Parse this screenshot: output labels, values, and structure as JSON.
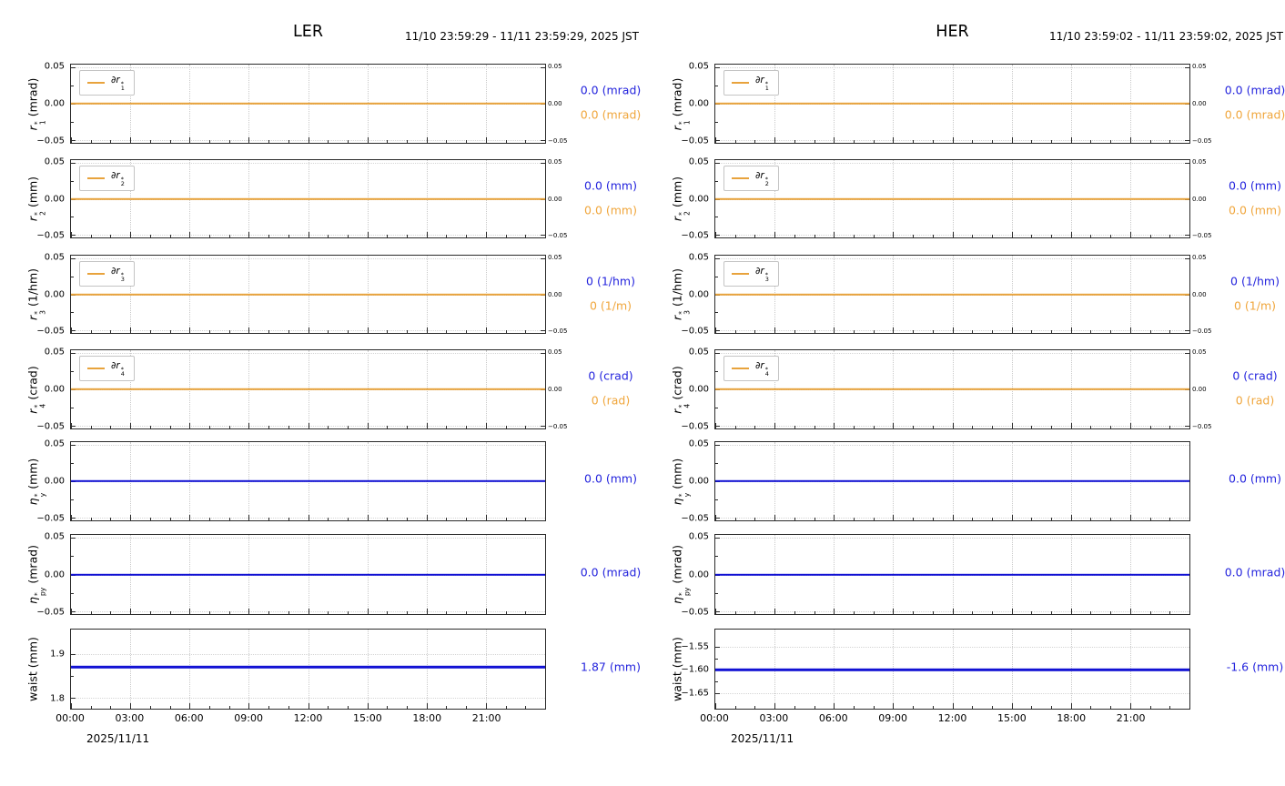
{
  "colors": {
    "orange": "#e8a33c",
    "orange_text": "#f0a63c",
    "blue": "#1212d4",
    "blue_text": "#2424dd",
    "grid": "#c9c9c9",
    "axis": "#2a2a2a"
  },
  "chart_data": [
    {
      "type": "line",
      "title": "LER",
      "time_range": "11/10 23:59:29 - 11/11 23:59:29, 2025 JST",
      "x": {
        "ticks": [
          "00:00",
          "03:00",
          "06:00",
          "09:00",
          "12:00",
          "15:00",
          "18:00",
          "21:00"
        ],
        "range_hours": [
          0,
          24
        ],
        "date_label": "2025/11/11"
      },
      "subplots": [
        {
          "ylabel": {
            "base": "r",
            "sub": "1",
            "sup": "*",
            "unit": "(mrad)"
          },
          "ylim": [
            -0.054,
            0.054
          ],
          "yticks": [
            {
              "label": "0.05",
              "value": 0.05
            },
            {
              "label": "0.00",
              "value": 0
            },
            {
              "label": "−0.05",
              "value": -0.05
            }
          ],
          "right_ticks": true,
          "legend": {
            "base": "∂r",
            "sub": "1",
            "sup": "*"
          },
          "series": [
            {
              "name": "∂r1*",
              "color": "#e8a33c",
              "value": 0
            }
          ],
          "readouts": [
            {
              "text": "0.0 (mrad)",
              "color": "#2424dd"
            },
            {
              "text": "0.0 (mrad)",
              "color": "#f0a63c"
            }
          ]
        },
        {
          "ylabel": {
            "base": "r",
            "sub": "2",
            "sup": "*",
            "unit": "(mm)"
          },
          "ylim": [
            -0.054,
            0.054
          ],
          "yticks": [
            {
              "label": "0.05",
              "value": 0.05
            },
            {
              "label": "0.00",
              "value": 0
            },
            {
              "label": "−0.05",
              "value": -0.05
            }
          ],
          "right_ticks": true,
          "legend": {
            "base": "∂r",
            "sub": "2",
            "sup": "*"
          },
          "series": [
            {
              "name": "∂r2*",
              "color": "#e8a33c",
              "value": 0
            }
          ],
          "readouts": [
            {
              "text": "0.0 (mm)",
              "color": "#2424dd"
            },
            {
              "text": "0.0 (mm)",
              "color": "#f0a63c"
            }
          ]
        },
        {
          "ylabel": {
            "base": "r",
            "sub": "3",
            "sup": "*",
            "unit": "(1/hm)"
          },
          "ylim": [
            -0.054,
            0.054
          ],
          "yticks": [
            {
              "label": "0.05",
              "value": 0.05
            },
            {
              "label": "0.00",
              "value": 0
            },
            {
              "label": "−0.05",
              "value": -0.05
            }
          ],
          "right_ticks": true,
          "legend": {
            "base": "∂r",
            "sub": "3",
            "sup": "*"
          },
          "series": [
            {
              "name": "∂r3*",
              "color": "#e8a33c",
              "value": 0
            }
          ],
          "readouts": [
            {
              "text": "0 (1/hm)",
              "color": "#2424dd"
            },
            {
              "text": "0 (1/m)",
              "color": "#f0a63c"
            }
          ]
        },
        {
          "ylabel": {
            "base": "r",
            "sub": "4",
            "sup": "*",
            "unit": "(crad)"
          },
          "ylim": [
            -0.054,
            0.054
          ],
          "yticks": [
            {
              "label": "0.05",
              "value": 0.05
            },
            {
              "label": "0.00",
              "value": 0
            },
            {
              "label": "−0.05",
              "value": -0.05
            }
          ],
          "right_ticks": true,
          "legend": {
            "base": "∂r",
            "sub": "4",
            "sup": "*"
          },
          "series": [
            {
              "name": "∂r4*",
              "color": "#e8a33c",
              "value": 0
            }
          ],
          "readouts": [
            {
              "text": "0 (crad)",
              "color": "#2424dd"
            },
            {
              "text": "0 (rad)",
              "color": "#f0a63c"
            }
          ]
        },
        {
          "ylabel": {
            "base": "η",
            "sub": "y",
            "sup": "*",
            "unit": "(mm)"
          },
          "ylim": [
            -0.054,
            0.054
          ],
          "yticks": [
            {
              "label": "0.05",
              "value": 0.05
            },
            {
              "label": "0.00",
              "value": 0
            },
            {
              "label": "−0.05",
              "value": -0.05
            }
          ],
          "right_ticks": false,
          "series": [
            {
              "name": "ηy*",
              "color": "#1212d4",
              "value": 0
            }
          ],
          "readouts": [
            {
              "text": "0.0 (mm)",
              "color": "#2424dd"
            }
          ]
        },
        {
          "ylabel": {
            "base": "η",
            "sub": "py",
            "sup": "*",
            "unit": "(mrad)"
          },
          "ylim": [
            -0.054,
            0.054
          ],
          "yticks": [
            {
              "label": "0.05",
              "value": 0.05
            },
            {
              "label": "0.00",
              "value": 0
            },
            {
              "label": "−0.05",
              "value": -0.05
            }
          ],
          "right_ticks": false,
          "series": [
            {
              "name": "ηpy*",
              "color": "#1212d4",
              "value": 0
            }
          ],
          "readouts": [
            {
              "text": "0.0 (mrad)",
              "color": "#2424dd"
            }
          ]
        },
        {
          "ylabel": {
            "plain": "waist (mm)"
          },
          "ylim": [
            1.7746,
            1.9564
          ],
          "yticks": [
            {
              "label": "1.9",
              "value": 1.9
            },
            {
              "label": "1.8",
              "value": 1.8
            }
          ],
          "right_ticks": false,
          "series": [
            {
              "name": "waist",
              "color": "#1212d4",
              "value": 1.87
            }
          ],
          "readouts": [
            {
              "text": "1.87 (mm)",
              "color": "#2424dd"
            }
          ]
        }
      ]
    },
    {
      "type": "line",
      "title": "HER",
      "time_range": "11/10 23:59:02 - 11/11 23:59:02, 2025 JST",
      "x": {
        "ticks": [
          "00:00",
          "03:00",
          "06:00",
          "09:00",
          "12:00",
          "15:00",
          "18:00",
          "21:00"
        ],
        "range_hours": [
          0,
          24
        ],
        "date_label": "2025/11/11"
      },
      "subplots": [
        {
          "ylabel": {
            "base": "r",
            "sub": "1",
            "sup": "*",
            "unit": "(mrad)"
          },
          "ylim": [
            -0.054,
            0.054
          ],
          "yticks": [
            {
              "label": "0.05",
              "value": 0.05
            },
            {
              "label": "0.00",
              "value": 0
            },
            {
              "label": "−0.05",
              "value": -0.05
            }
          ],
          "right_ticks": true,
          "legend": {
            "base": "∂r",
            "sub": "1",
            "sup": "*"
          },
          "series": [
            {
              "name": "∂r1*",
              "color": "#e8a33c",
              "value": 0
            }
          ],
          "readouts": [
            {
              "text": "0.0 (mrad)",
              "color": "#2424dd"
            },
            {
              "text": "0.0 (mrad)",
              "color": "#f0a63c"
            }
          ]
        },
        {
          "ylabel": {
            "base": "r",
            "sub": "2",
            "sup": "*",
            "unit": "(mm)"
          },
          "ylim": [
            -0.054,
            0.054
          ],
          "yticks": [
            {
              "label": "0.05",
              "value": 0.05
            },
            {
              "label": "0.00",
              "value": 0
            },
            {
              "label": "−0.05",
              "value": -0.05
            }
          ],
          "right_ticks": true,
          "legend": {
            "base": "∂r",
            "sub": "2",
            "sup": "*"
          },
          "series": [
            {
              "name": "∂r2*",
              "color": "#e8a33c",
              "value": 0
            }
          ],
          "readouts": [
            {
              "text": "0.0 (mm)",
              "color": "#2424dd"
            },
            {
              "text": "0.0 (mm)",
              "color": "#f0a63c"
            }
          ]
        },
        {
          "ylabel": {
            "base": "r",
            "sub": "3",
            "sup": "*",
            "unit": "(1/hm)"
          },
          "ylim": [
            -0.054,
            0.054
          ],
          "yticks": [
            {
              "label": "0.05",
              "value": 0.05
            },
            {
              "label": "0.00",
              "value": 0
            },
            {
              "label": "−0.05",
              "value": -0.05
            }
          ],
          "right_ticks": true,
          "legend": {
            "base": "∂r",
            "sub": "3",
            "sup": "*"
          },
          "series": [
            {
              "name": "∂r3*",
              "color": "#e8a33c",
              "value": 0
            }
          ],
          "readouts": [
            {
              "text": "0 (1/hm)",
              "color": "#2424dd"
            },
            {
              "text": "0 (1/m)",
              "color": "#f0a63c"
            }
          ]
        },
        {
          "ylabel": {
            "base": "r",
            "sub": "4",
            "sup": "*",
            "unit": "(crad)"
          },
          "ylim": [
            -0.054,
            0.054
          ],
          "yticks": [
            {
              "label": "0.05",
              "value": 0.05
            },
            {
              "label": "0.00",
              "value": 0
            },
            {
              "label": "−0.05",
              "value": -0.05
            }
          ],
          "right_ticks": true,
          "legend": {
            "base": "∂r",
            "sub": "4",
            "sup": "*"
          },
          "series": [
            {
              "name": "∂r4*",
              "color": "#e8a33c",
              "value": 0
            }
          ],
          "readouts": [
            {
              "text": "0 (crad)",
              "color": "#2424dd"
            },
            {
              "text": "0 (rad)",
              "color": "#f0a63c"
            }
          ]
        },
        {
          "ylabel": {
            "base": "η",
            "sub": "y",
            "sup": "*",
            "unit": "(mm)"
          },
          "ylim": [
            -0.054,
            0.054
          ],
          "yticks": [
            {
              "label": "0.05",
              "value": 0.05
            },
            {
              "label": "0.00",
              "value": 0
            },
            {
              "label": "−0.05",
              "value": -0.05
            }
          ],
          "right_ticks": false,
          "series": [
            {
              "name": "ηy*",
              "color": "#1212d4",
              "value": 0
            }
          ],
          "readouts": [
            {
              "text": "0.0 (mm)",
              "color": "#2424dd"
            }
          ]
        },
        {
          "ylabel": {
            "base": "η",
            "sub": "py",
            "sup": "*",
            "unit": "(mrad)"
          },
          "ylim": [
            -0.054,
            0.054
          ],
          "yticks": [
            {
              "label": "0.05",
              "value": 0.05
            },
            {
              "label": "0.00",
              "value": 0
            },
            {
              "label": "−0.05",
              "value": -0.05
            }
          ],
          "right_ticks": false,
          "series": [
            {
              "name": "ηpy*",
              "color": "#1212d4",
              "value": 0
            }
          ],
          "readouts": [
            {
              "text": "0.0 (mrad)",
              "color": "#2424dd"
            }
          ]
        },
        {
          "ylabel": {
            "plain": "waist (mm)"
          },
          "ylim": [
            -1.6845,
            -1.512
          ],
          "yticks": [
            {
              "label": "−1.55",
              "value": -1.55
            },
            {
              "label": "−1.60",
              "value": -1.6
            },
            {
              "label": "−1.65",
              "value": -1.65
            }
          ],
          "right_ticks": false,
          "series": [
            {
              "name": "waist",
              "color": "#1212d4",
              "value": -1.6
            }
          ],
          "readouts": [
            {
              "text": "-1.6 (mm)",
              "color": "#2424dd"
            }
          ]
        }
      ]
    }
  ]
}
